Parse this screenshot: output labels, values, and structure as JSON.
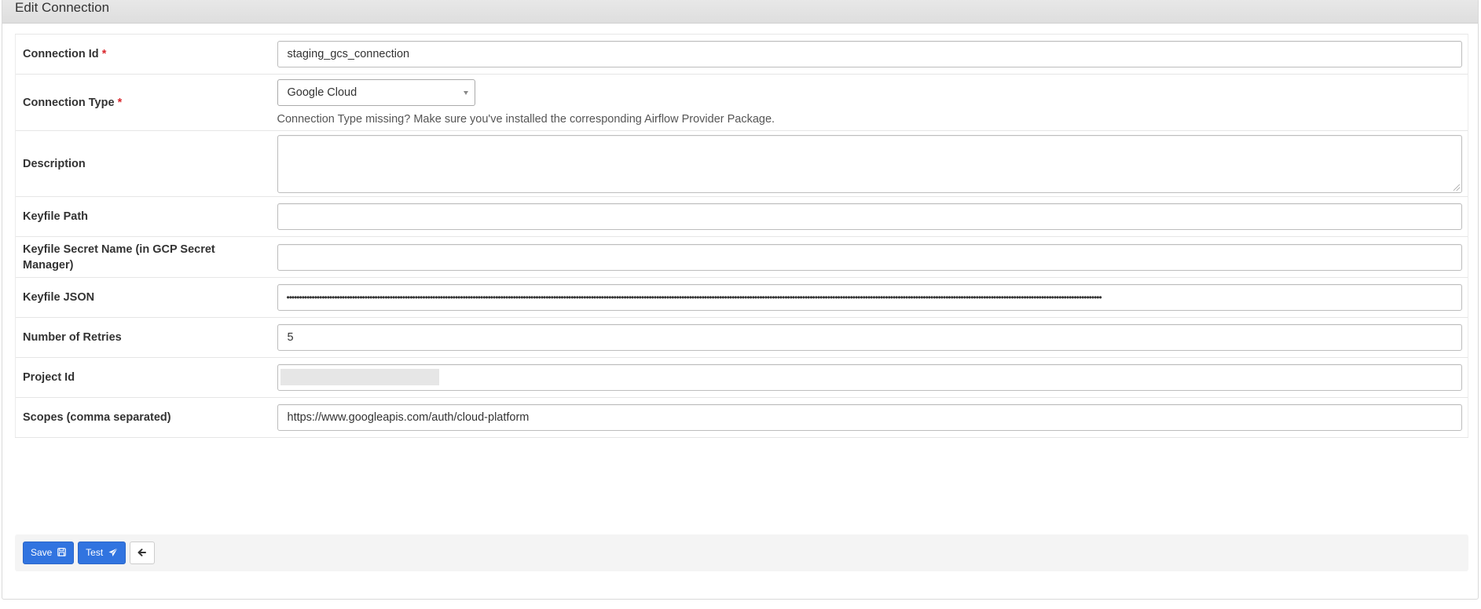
{
  "panel": {
    "title": "Edit Connection"
  },
  "required_marker": "*",
  "fields": {
    "connection_id": {
      "label": "Connection Id",
      "value": "staging_gcs_connection"
    },
    "connection_type": {
      "label": "Connection Type",
      "value": "Google Cloud",
      "help": "Connection Type missing? Make sure you've installed the corresponding Airflow Provider Package."
    },
    "description": {
      "label": "Description",
      "value": ""
    },
    "keyfile_path": {
      "label": "Keyfile Path",
      "value": ""
    },
    "keyfile_secret": {
      "label": "Keyfile Secret Name (in GCP Secret Manager)",
      "value": ""
    },
    "keyfile_json": {
      "label": "Keyfile JSON",
      "value": "••••••••••••••••••••••••••••••••••••••••••••••••••••••••••••••••••••••••••••••••••••••••••••••••••••••••••••••••••••••••••••••••••••••••••••••••••••••••••••••••••••••••••••••••••••••••••••••••••••••••••••••••••••••••••••••••••••••••••••••••••••••••••••••••••••••••••••••••••••••••••••••••••••••••••••••••••••••••••••••••••••"
    },
    "num_retries": {
      "label": "Number of Retries",
      "value": "5"
    },
    "project_id": {
      "label": "Project Id",
      "value": ""
    },
    "scopes": {
      "label": "Scopes (comma separated)",
      "value": "https://www.googleapis.com/auth/cloud-platform"
    }
  },
  "actions": {
    "save_label": "Save",
    "test_label": "Test",
    "primary_color": "#3174e0"
  },
  "icons": {
    "save": "floppy-disk-icon",
    "test": "paper-plane-icon",
    "back": "arrow-left-icon"
  }
}
